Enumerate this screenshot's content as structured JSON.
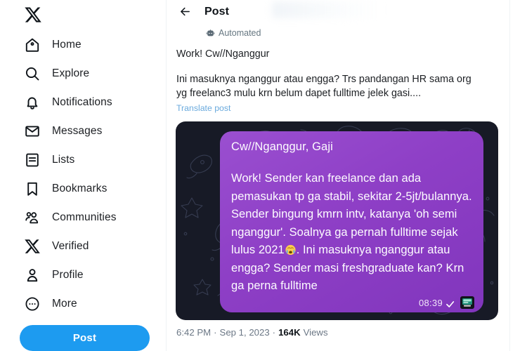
{
  "sidebar": {
    "logo": {
      "icon": "x-logo-icon"
    },
    "items": [
      {
        "label": "Home",
        "icon": "home-icon"
      },
      {
        "label": "Explore",
        "icon": "search-icon"
      },
      {
        "label": "Notifications",
        "icon": "bell-icon"
      },
      {
        "label": "Messages",
        "icon": "envelope-icon"
      },
      {
        "label": "Lists",
        "icon": "list-icon"
      },
      {
        "label": "Bookmarks",
        "icon": "bookmark-icon"
      },
      {
        "label": "Communities",
        "icon": "people-icon"
      },
      {
        "label": "Verified",
        "icon": "x-logo-icon"
      },
      {
        "label": "Profile",
        "icon": "person-icon"
      },
      {
        "label": "More",
        "icon": "more-circle-icon"
      }
    ],
    "post_button": {
      "label": "Post",
      "color": "#1d9bf0"
    }
  },
  "topbar": {
    "back_icon": "back-arrow-icon",
    "title": "Post"
  },
  "post": {
    "automated_badge": {
      "icon": "robot-icon",
      "label": "Automated"
    },
    "title_line": "Work! Cw//Nganggur",
    "body": "Ini masuknya nganggur atau engga? Trs pandangan HR sama org yg freelanc3 mulu krn belum dapet fulltime jelek gasi....",
    "translate_link": "Translate post",
    "footer": {
      "time": "6:42 PM",
      "separator_1": "·",
      "date": "Sep 1, 2023",
      "separator_2": "·",
      "views_count": "164K",
      "views_label": "Views"
    }
  },
  "media": {
    "background_color": "#171a26",
    "bubble_color": "#8e3fc6",
    "bubble_title": "Cw//Nganggur, Gaji",
    "bubble_text": "Work! Sender kan freelance dan ada pemasukan tp ga stabil, sekitar 2-5jt/bulannya. Sender bingung kmrn intv, katanya 'oh semi nganggur'. Soalnya ga pernah fulltime sejak lulus 2021",
    "bubble_text_2": ". Ini masuknya nganggur atau engga? Sender masi freshgraduate kan? Krn ga perna fulltime",
    "emoji": "loudly-crying-face",
    "bubble_time": "08:39",
    "read_receipt_icon": "double-check-icon",
    "sticker_icon": "sticker-thumbnail-icon"
  }
}
